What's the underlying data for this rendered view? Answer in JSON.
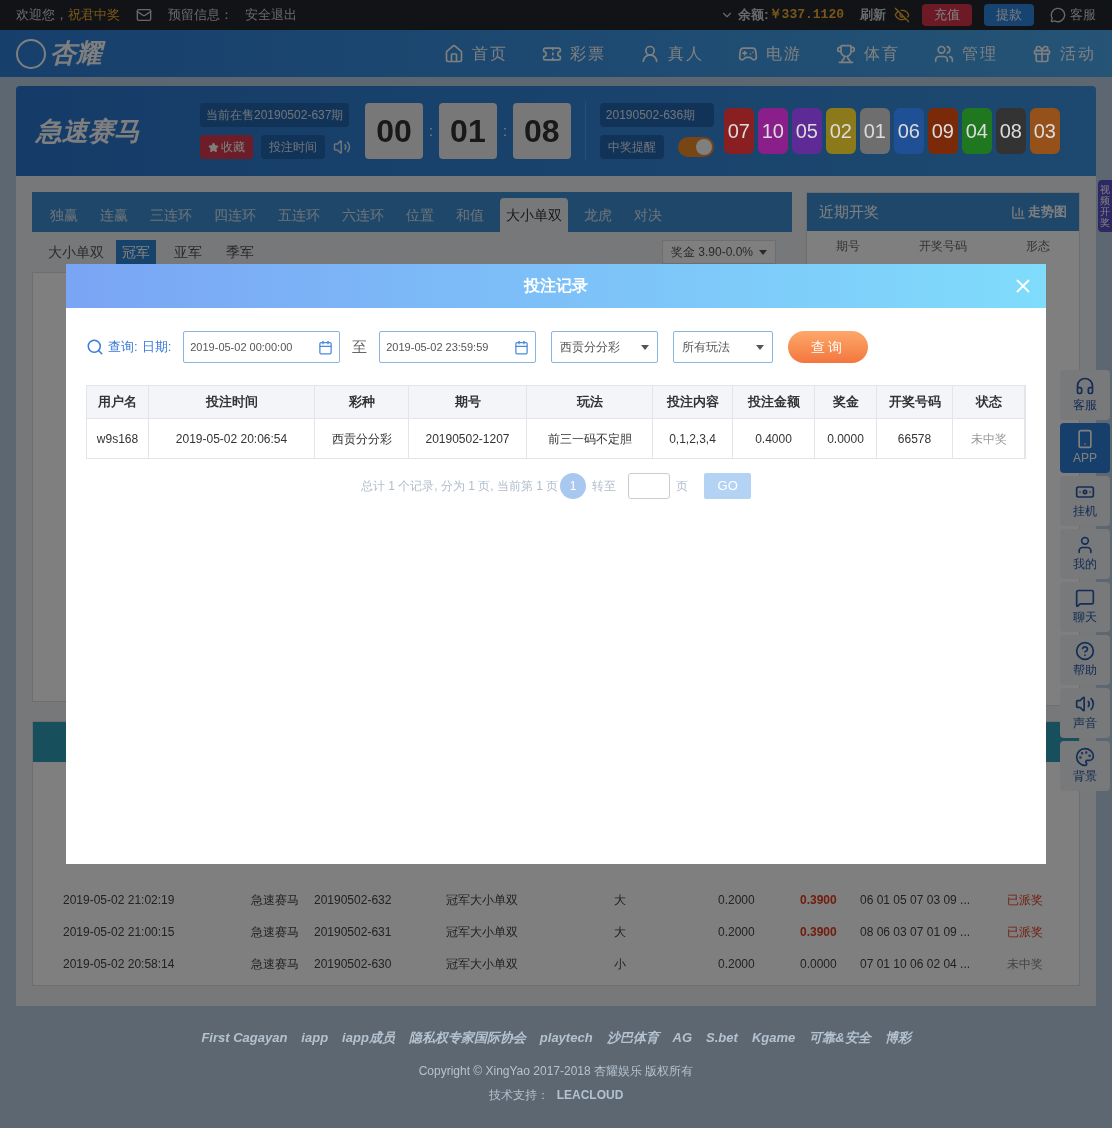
{
  "top_bar": {
    "welcome": "欢迎您，",
    "username": "祝君中奖",
    "reserved_info": "预留信息：",
    "logout": "安全退出",
    "balance_label": "余额:",
    "balance": "￥337.1120",
    "refresh": "刷新",
    "buttons": [
      {
        "label": "充值",
        "kind": "recharge"
      },
      {
        "label": "提款",
        "kind": "withdraw"
      }
    ],
    "service": "客服"
  },
  "nav": {
    "logo": "杏耀",
    "items": [
      {
        "label": "首页"
      },
      {
        "label": "彩票"
      },
      {
        "label": "真人"
      },
      {
        "label": "电游"
      },
      {
        "label": "体育"
      },
      {
        "label": "管理"
      },
      {
        "label": "活动"
      }
    ]
  },
  "header": {
    "game_title": "急速赛马",
    "current_issue": "当前在售20190502-637期",
    "favorite": "收藏",
    "bet_time": "投注时间",
    "countdown": [
      "00",
      "01",
      "08"
    ],
    "countdown_separator": ":",
    "last_issue": "20190502-636期",
    "win_alert": "中奖提醒",
    "win_alert_on": true,
    "balls": [
      {
        "number": "07",
        "color": "#8a1f22"
      },
      {
        "number": "10",
        "color": "#8a1f8c"
      },
      {
        "number": "05",
        "color": "#5e2a96"
      },
      {
        "number": "02",
        "color": "#8c7a1a"
      },
      {
        "number": "01",
        "color": "#6e6e6e"
      },
      {
        "number": "06",
        "color": "#1f4f94"
      },
      {
        "number": "09",
        "color": "#7a2a08"
      },
      {
        "number": "04",
        "color": "#1f781f"
      },
      {
        "number": "08",
        "color": "#333333"
      },
      {
        "number": "03",
        "color": "#96501a"
      }
    ]
  },
  "tabs": [
    {
      "label": "独赢",
      "selected": false
    },
    {
      "label": "连赢",
      "selected": false
    },
    {
      "label": "三连环",
      "selected": false
    },
    {
      "label": "四连环",
      "selected": false
    },
    {
      "label": "五连环",
      "selected": false
    },
    {
      "label": "六连环",
      "selected": false
    },
    {
      "label": "位置",
      "selected": false
    },
    {
      "label": "和值",
      "selected": false
    },
    {
      "label": "大小单双",
      "selected": true
    },
    {
      "label": "龙虎",
      "selected": false
    },
    {
      "label": "对决",
      "selected": false
    }
  ],
  "sub_tabs": {
    "label": "大小单双",
    "items": [
      {
        "label": "冠军",
        "selected": true
      },
      {
        "label": "亚军",
        "selected": false
      },
      {
        "label": "季军",
        "selected": false
      }
    ],
    "prize_select": "奖金 3.90-0.0%"
  },
  "recent_draws": {
    "title": "近期开奖",
    "trend": "走势图",
    "columns": [
      "期号",
      "开奖号码",
      "形态"
    ]
  },
  "video_tab": "视频开奖",
  "bet_history": {
    "rows": [
      {
        "time": "2019-05-02 21:02:19",
        "game": "急速赛马",
        "issue": "20190502-632",
        "play": "冠军大小单双",
        "content": "大",
        "amount": "0.2000",
        "prize": "0.3900",
        "numbers": "06 01 05 07 03 09 ...",
        "status": "已派奖",
        "won": true
      },
      {
        "time": "2019-05-02 21:00:15",
        "game": "急速赛马",
        "issue": "20190502-631",
        "play": "冠军大小单双",
        "content": "大",
        "amount": "0.2000",
        "prize": "0.3900",
        "numbers": "08 06 03 07 01 09 ...",
        "status": "已派奖",
        "won": true
      },
      {
        "time": "2019-05-02 20:58:14",
        "game": "急速赛马",
        "issue": "20190502-630",
        "play": "冠军大小单双",
        "content": "小",
        "amount": "0.2000",
        "prize": "0.0000",
        "numbers": "07 01 10 06 02 04 ...",
        "status": "未中奖",
        "won": false
      }
    ]
  },
  "sidebar": [
    {
      "label": "客服",
      "selected": false
    },
    {
      "label": "APP",
      "selected": true
    },
    {
      "label": "挂机",
      "selected": false
    },
    {
      "label": "我的",
      "selected": false
    },
    {
      "label": "聊天",
      "selected": false
    },
    {
      "label": "帮助",
      "selected": false
    },
    {
      "label": "声音",
      "selected": false
    },
    {
      "label": "背景",
      "selected": false
    }
  ],
  "footer": {
    "logos": [
      "First Cagayan",
      "iapp",
      "iapp成员",
      "隐私权专家国际协会",
      "playtech",
      "沙巴体育",
      "AG",
      "S.bet",
      "Kgame",
      "可靠&安全",
      "博彩"
    ],
    "copyright": "Copyright © XingYao 2017-2018 杏耀娱乐 版权所有",
    "tech_support": "技术支持：",
    "tech_brand": "LEACLOUD"
  },
  "modal": {
    "title": "投注记录",
    "query_label": "查询:",
    "date_label": "日期:",
    "start_date": "2019-05-02 00:00:00",
    "to": "至",
    "end_date": "2019-05-02 23:59:59",
    "lottery_select": "西贡分分彩",
    "play_select": "所有玩法",
    "query_button": "查询",
    "columns": [
      "用户名",
      "投注时间",
      "彩种",
      "期号",
      "玩法",
      "投注内容",
      "投注金额",
      "奖金",
      "开奖号码",
      "状态"
    ],
    "rows": [
      {
        "cells": [
          "w9s168",
          "2019-05-02 20:06:54",
          "西贡分分彩",
          "20190502-1207",
          "前三一码不定胆",
          "0,1,2,3,4",
          "0.4000",
          "0.0000",
          "66578",
          "未中奖"
        ],
        "won": false
      }
    ],
    "pagination": {
      "summary": "总计 1 个记录, 分为 1 页, 当前第 1 页",
      "pages": [
        {
          "label": "1",
          "selected": true
        }
      ],
      "goto": "转至",
      "page_unit": "页",
      "go": "GO"
    }
  }
}
